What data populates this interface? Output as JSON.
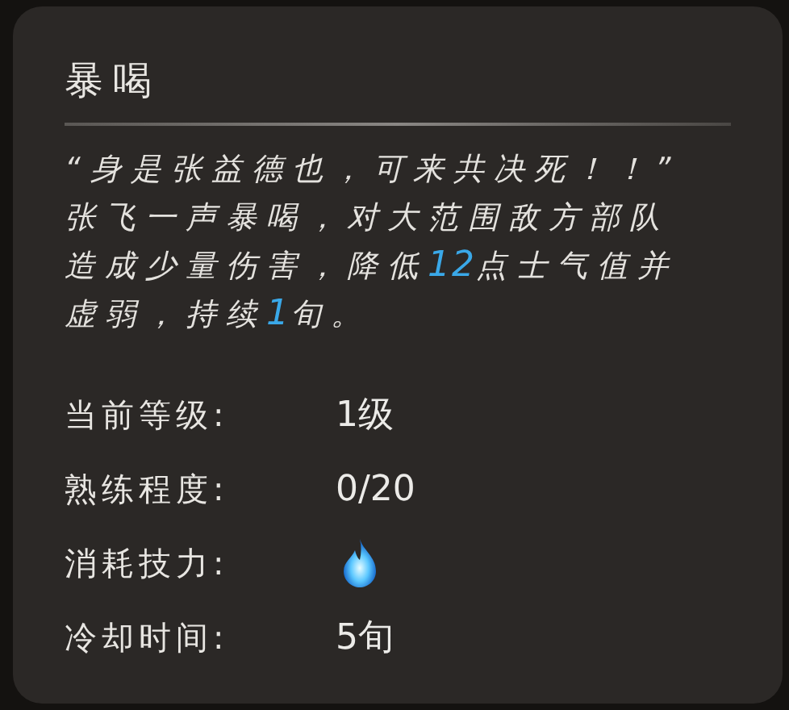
{
  "tooltip": {
    "title": "暴喝",
    "description": [
      [
        {
          "text": "“身是张益德也，可来共决死！！”",
          "highlight": false
        }
      ],
      [
        {
          "text": "张飞一声暴喝，对大范围敌方部队",
          "highlight": false
        }
      ],
      [
        {
          "text": "造成少量伤害，降低",
          "highlight": false
        },
        {
          "text": "12",
          "highlight": true
        },
        {
          "text": "点士气值并",
          "highlight": false
        }
      ],
      [
        {
          "text": "虚弱，持续",
          "highlight": false
        },
        {
          "text": "1",
          "highlight": true
        },
        {
          "text": "旬。",
          "highlight": false
        }
      ]
    ],
    "stats": [
      {
        "label": "当前等级:",
        "kind": "text",
        "value": "1级"
      },
      {
        "label": "熟练程度:",
        "kind": "text",
        "value": "0/20"
      },
      {
        "label": "消耗技力:",
        "kind": "flame"
      },
      {
        "label": "冷却时间:",
        "kind": "text",
        "value": "5旬"
      }
    ]
  }
}
